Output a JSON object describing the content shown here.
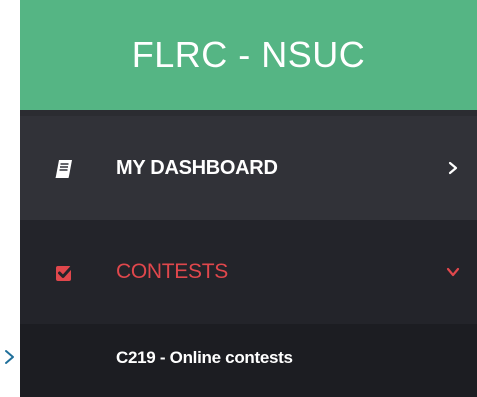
{
  "brand": {
    "title": "FLRC - NSUC",
    "color": "#55b584"
  },
  "menu": {
    "items": [
      {
        "label": "MY DASHBOARD",
        "icon": "book-icon",
        "chevron": "chevron-right-icon",
        "active": false
      },
      {
        "label": "CONTESTS",
        "icon": "checkbox-checked-icon",
        "chevron": "chevron-down-icon",
        "active": true,
        "accent": "#e0474c"
      }
    ],
    "submenu": [
      {
        "label": "C219 - Online contests"
      }
    ]
  },
  "colors": {
    "sidebar_bg": "#23242a",
    "active_accent": "#e0474c",
    "pointer": "#1f6f9a"
  },
  "icons": {
    "pointer": "chevron-right-icon"
  }
}
